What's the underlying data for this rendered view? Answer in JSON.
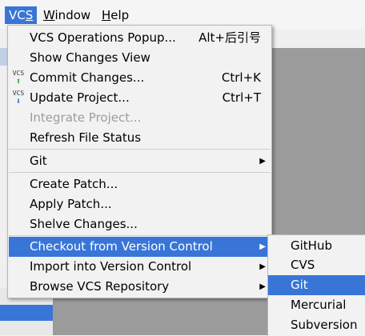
{
  "menubar": {
    "vcs": "VCS",
    "window": "Window",
    "help": "Help"
  },
  "vcs_menu": {
    "items": [
      {
        "label": "VCS Operations Popup...",
        "shortcut": "Alt+后引号"
      },
      {
        "label": "Show Changes View"
      },
      {
        "label": "Commit Changes...",
        "shortcut": "Ctrl+K",
        "icon": "vcs-commit-icon"
      },
      {
        "label": "Update Project...",
        "shortcut": "Ctrl+T",
        "icon": "vcs-update-icon"
      },
      {
        "label": "Integrate Project...",
        "disabled": true
      },
      {
        "label": "Refresh File Status"
      },
      {
        "label": "Git",
        "submenu": true
      },
      {
        "label": "Create Patch..."
      },
      {
        "label": "Apply Patch..."
      },
      {
        "label": "Shelve Changes..."
      },
      {
        "label": "Checkout from Version Control",
        "submenu": true,
        "selected": true
      },
      {
        "label": "Import into Version Control",
        "submenu": true
      },
      {
        "label": "Browse VCS Repository",
        "submenu": true
      }
    ]
  },
  "checkout_submenu": {
    "items": [
      {
        "label": "GitHub"
      },
      {
        "label": "CVS"
      },
      {
        "label": "Git",
        "selected": true
      },
      {
        "label": "Mercurial"
      },
      {
        "label": "Subversion"
      }
    ]
  },
  "icons": {
    "vcs_label": "VCS",
    "submenu_arrow": "▶",
    "up_arrow": "⬆",
    "down_arrow": "⬇"
  },
  "colors": {
    "selection": "#3875d7",
    "menu_bg": "#f2f2f2",
    "disabled_text": "#9c9c9c",
    "commit_arrow": "#2e9e3e",
    "update_arrow": "#2f6fd0"
  }
}
